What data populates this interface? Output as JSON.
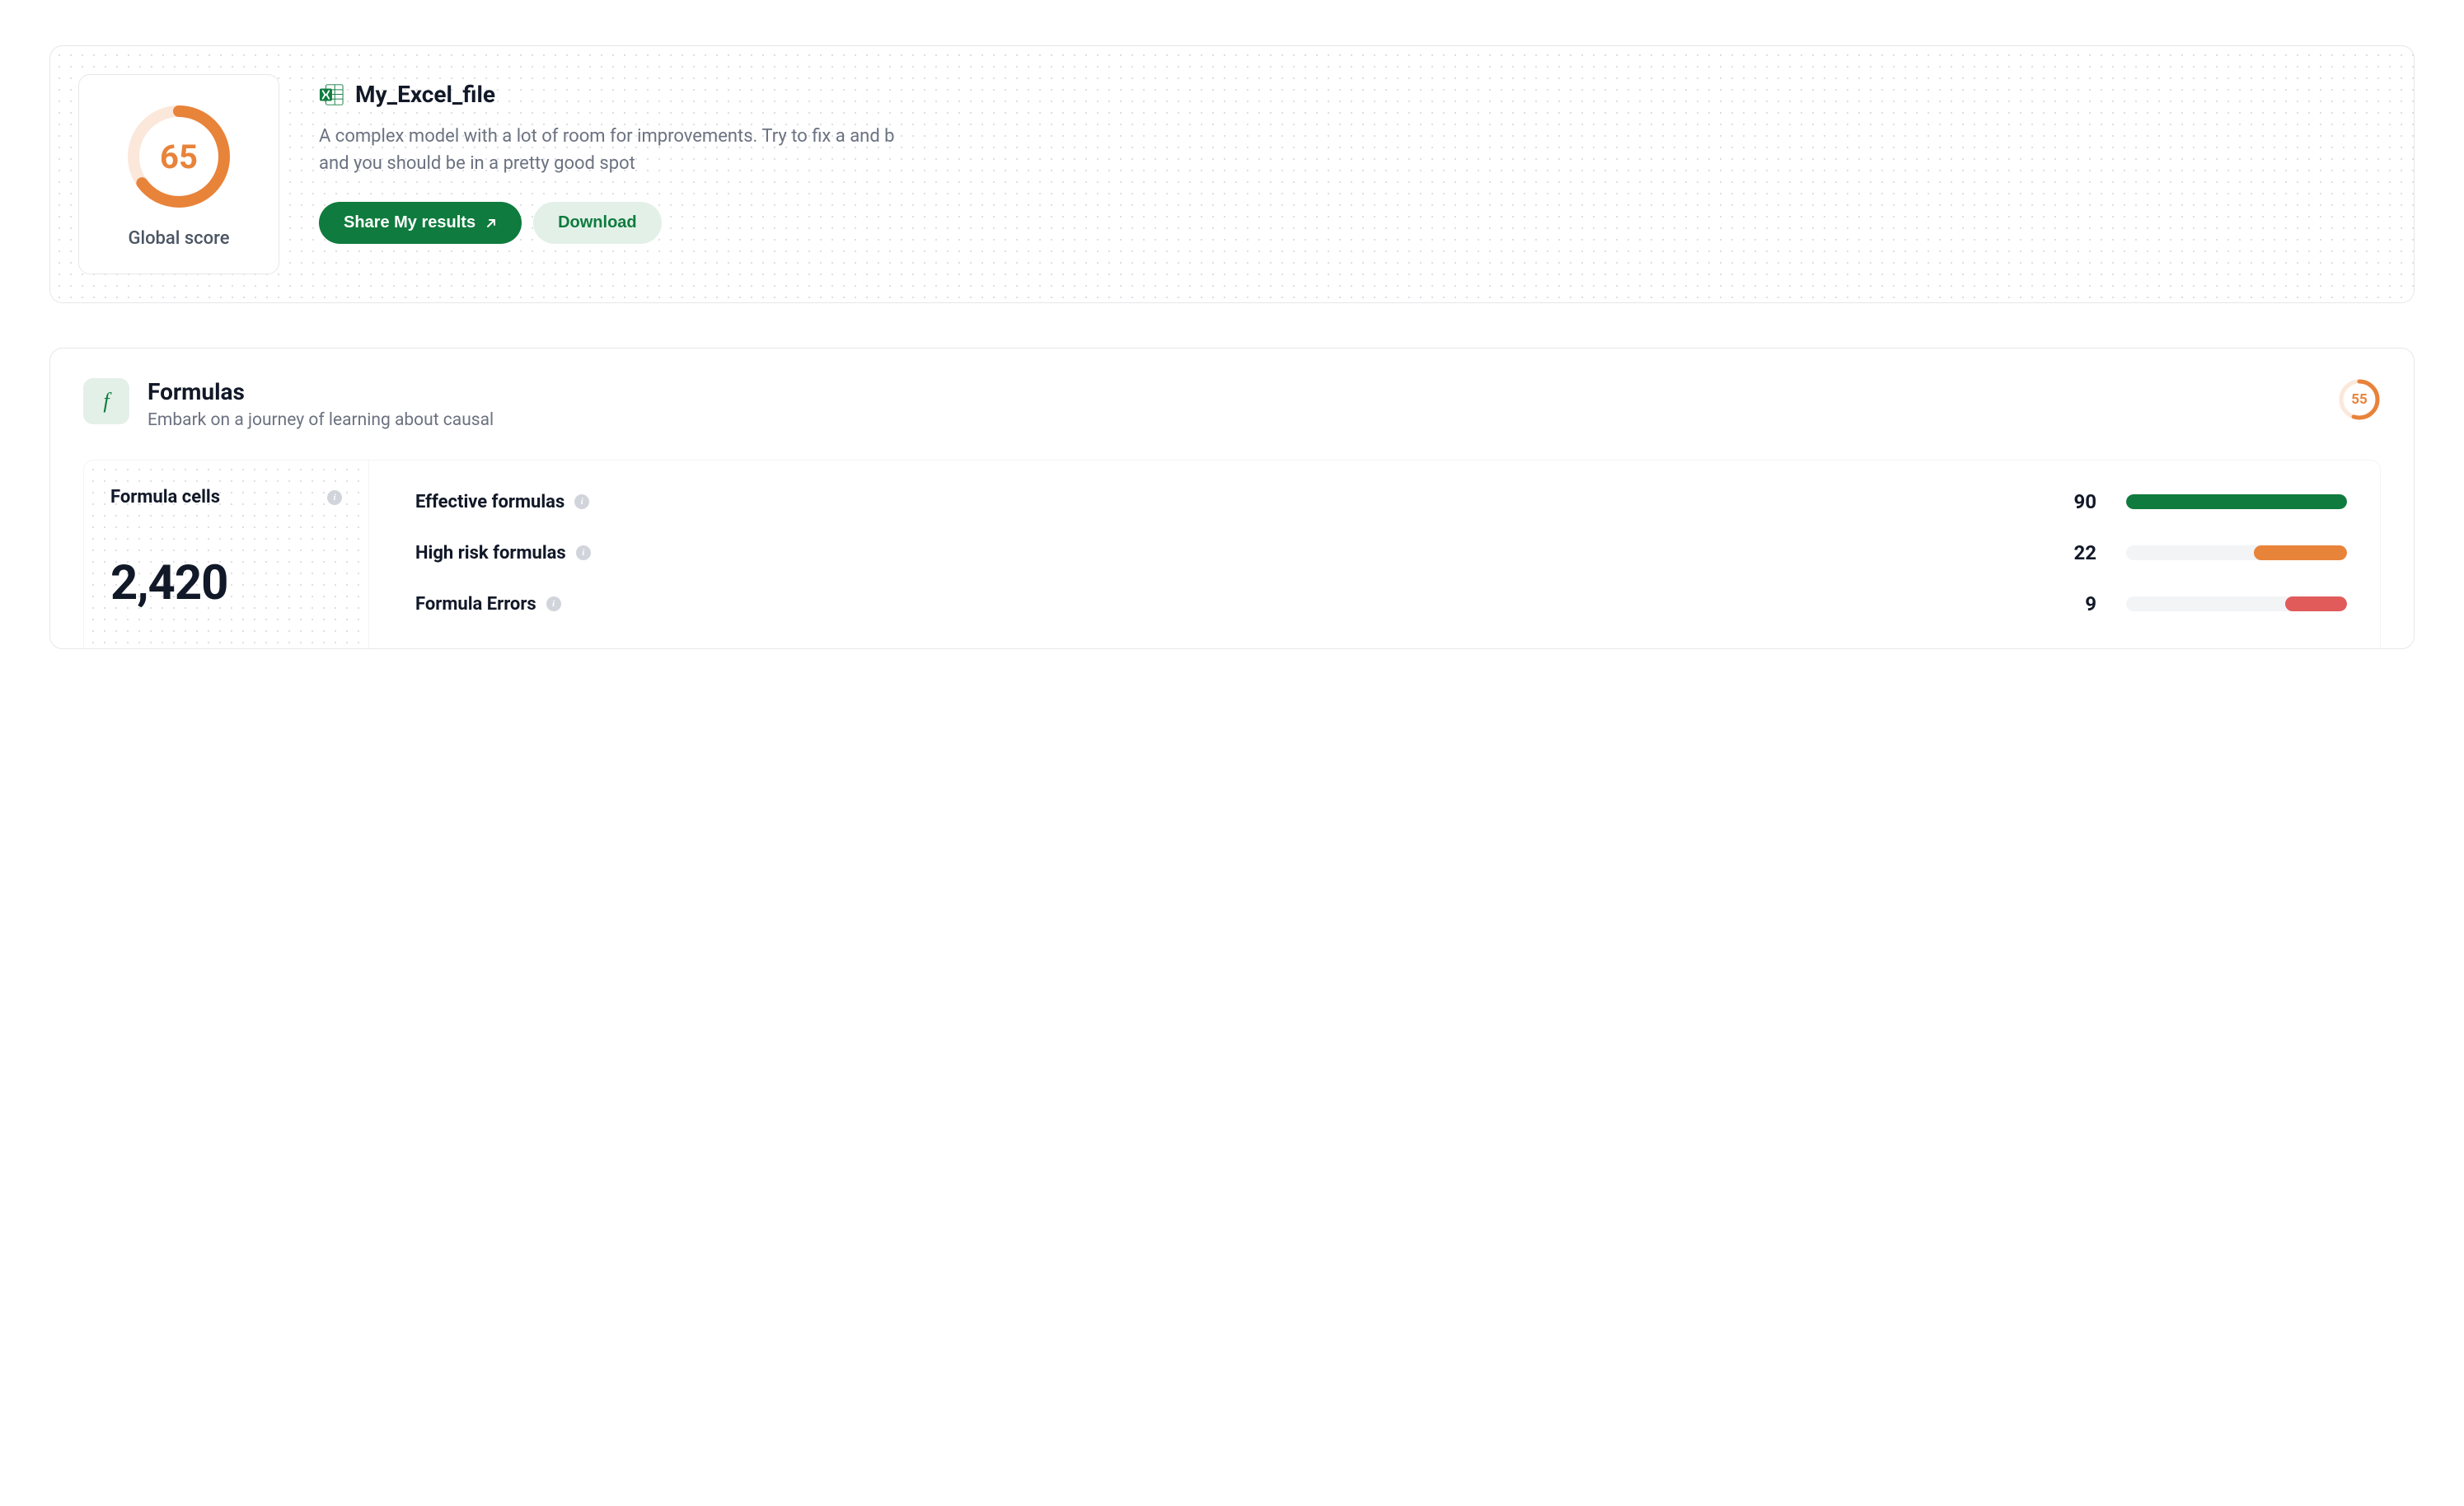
{
  "global": {
    "score": "65",
    "label": "Global score",
    "percent": 65
  },
  "file": {
    "name": "My_Excel_file",
    "description": "A complex model with a lot of room for improvements. Try to fix a and b and you should be in a pretty good spot",
    "share_label": "Share My results",
    "download_label": "Download"
  },
  "formulas": {
    "title": "Formulas",
    "subtitle": "Embark on a journey of learning about causal",
    "score": "55",
    "percent": 55,
    "cells_label": "Formula cells",
    "cells_count": "2,420",
    "metrics": [
      {
        "label": "Effective formulas",
        "value": "90",
        "percent": 100,
        "color": "green",
        "align": "left"
      },
      {
        "label": "High risk formulas",
        "value": "22",
        "percent": 42,
        "color": "orange",
        "align": "right"
      },
      {
        "label": "Formula Errors",
        "value": "9",
        "percent": 28,
        "color": "red",
        "align": "right"
      }
    ]
  },
  "colors": {
    "orange": "#E8833A",
    "green": "#0F7B3E",
    "red": "#E15B5B",
    "ring_bg": "#FBE8DB"
  }
}
